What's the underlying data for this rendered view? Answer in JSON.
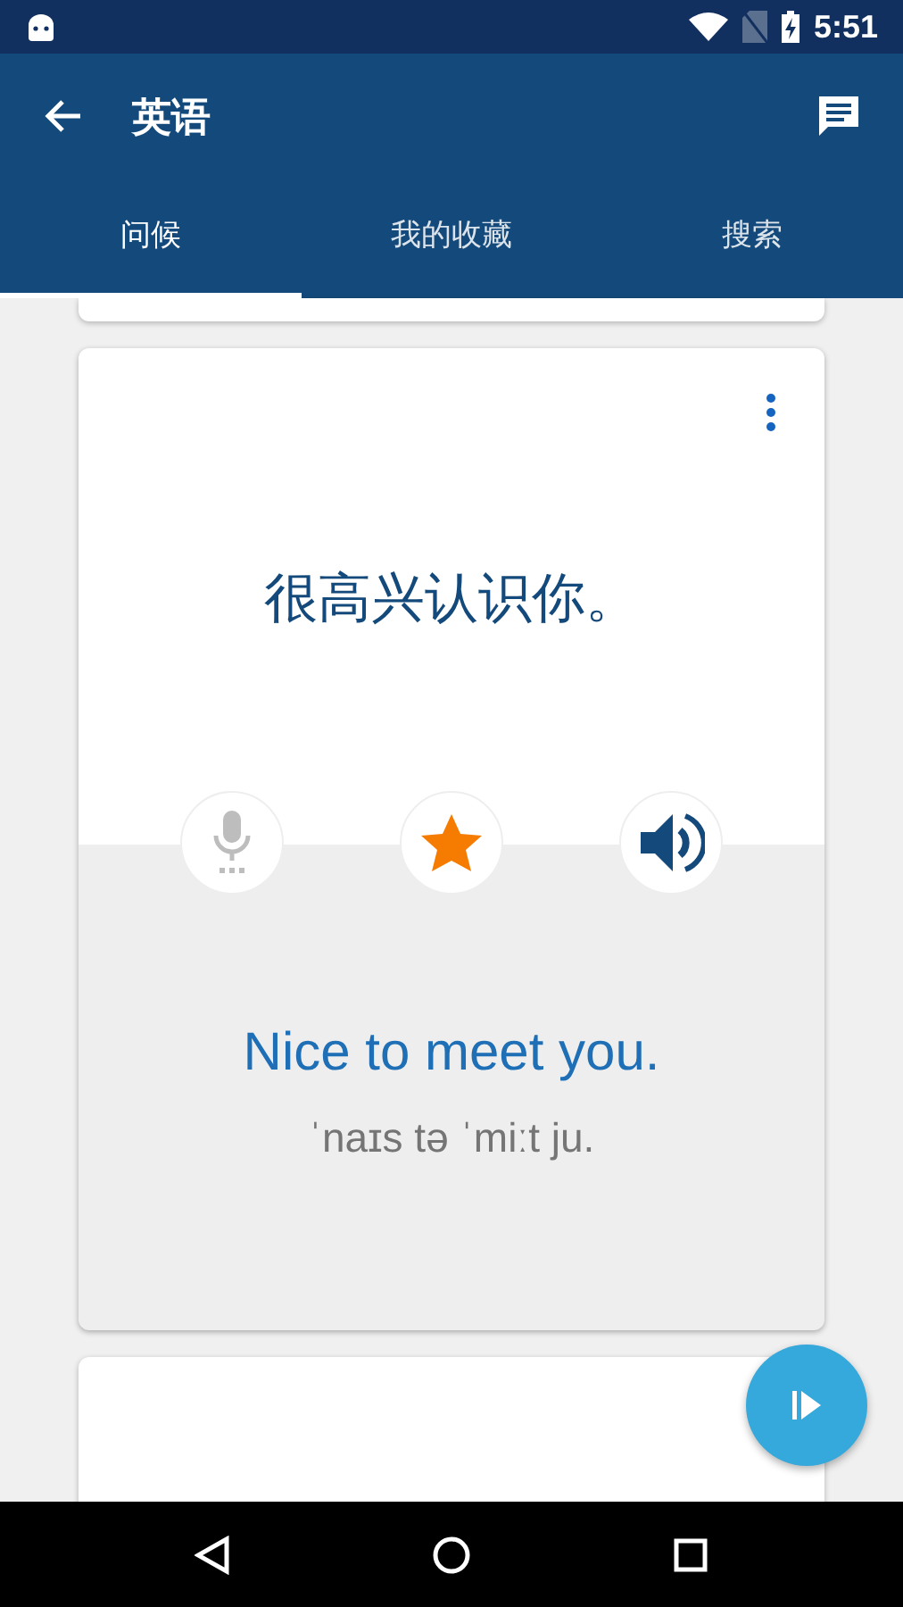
{
  "status_bar": {
    "time": "5:51"
  },
  "app_bar": {
    "title": "英语"
  },
  "tabs": [
    {
      "label": "问候",
      "selected": true
    },
    {
      "label": "我的收藏",
      "selected": false
    },
    {
      "label": "搜索",
      "selected": false
    }
  ],
  "phrase_card": {
    "source": "很高兴认识你。",
    "favorited": true,
    "translation": "Nice to meet you.",
    "pronunciation": "ˈnaɪs tə ˈmiːt ju."
  }
}
